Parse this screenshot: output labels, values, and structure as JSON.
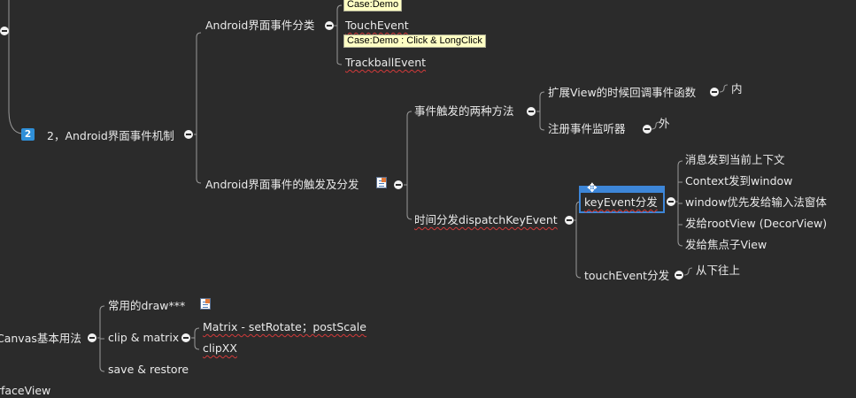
{
  "colors": {
    "background": "#2b2b2b",
    "branch": "#9a9a9a",
    "text": "#eaeaea",
    "spell_underline": "#d23a3a",
    "note_bg": "#ffffc4",
    "selection": "#3d86d8",
    "badge": "#2f8fd8"
  },
  "badge": "2",
  "nodes": {
    "mechanism": "2，Android界面事件机制",
    "categories": "Android界面事件分类",
    "touch_event": "TouchEvent",
    "trackball_event": "TrackballEvent",
    "dispatch": "Android界面事件的触发及分发",
    "two_ways": "事件触发的两种方法",
    "extend_view": "扩展View的时候回调事件函数",
    "inner": "内",
    "register_listener": "注册事件监听器",
    "outer": "外",
    "time_dispatch": "时间分发dispatchKeyEvent",
    "key_event": "keyEvent分发",
    "msg_context": "消息发到当前上下文",
    "context_window": "Context发到window",
    "window_ime": "window优先发给输入法窗体",
    "root_view": "发给rootView (DecorView)",
    "focus_child": "发给焦点子View",
    "touch_dispatch": "touchEvent分发",
    "bottom_up": "从下往上",
    "canvas": "Canvas基本用法",
    "common_draw": "常用的draw***",
    "clip_matrix": "clip & matrix",
    "matrix_ops": "Matrix - setRotate；postScale",
    "clipxx": "clipXX",
    "save_restore": "save & restore",
    "surface_view": "SurfaceView"
  },
  "notes": {
    "case_demo": "Case:Demo",
    "case_click": "Case:Demo : Click & LongClick"
  },
  "icons": [
    "collapse-icon",
    "note-icon",
    "move-cursor-icon",
    "priority-badge-icon"
  ]
}
